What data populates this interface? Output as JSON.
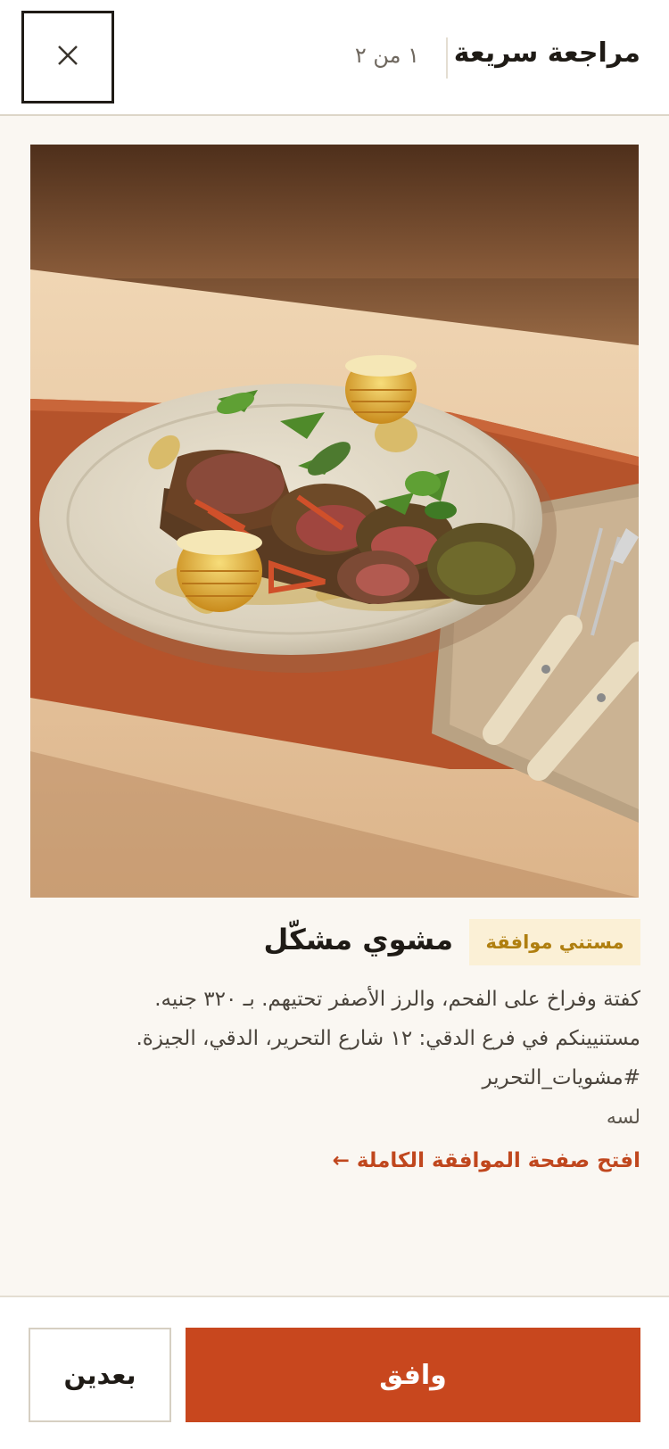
{
  "header": {
    "title": "مراجعة سريعة",
    "counter": "١ من ٢",
    "close_icon": "close-icon"
  },
  "post": {
    "image_alt": "mixed-grill-plate-photo",
    "badge": "مستني موافقة",
    "dish_name": "مشوي مشكّل",
    "caption_line1": "كفتة وفراخ على الفحم، والرز الأصفر تحتيهم. بـ ٣٢٠ جنيه.",
    "caption_line2": "مستنيينكم في فرع الدقي: ١٢ شارع التحرير، الدقي، الجيزة.",
    "hashtag": "#مشويات_التحرير",
    "status_text": "لسه",
    "open_full_link": "افتح صفحة الموافقة الكاملة ←"
  },
  "footer": {
    "approve_label": "وافق",
    "later_label": "بعدين"
  },
  "colors": {
    "accent": "#c8471e",
    "badge_bg": "#fbf0d6",
    "badge_text": "#b07f10",
    "link": "#c0471e"
  }
}
